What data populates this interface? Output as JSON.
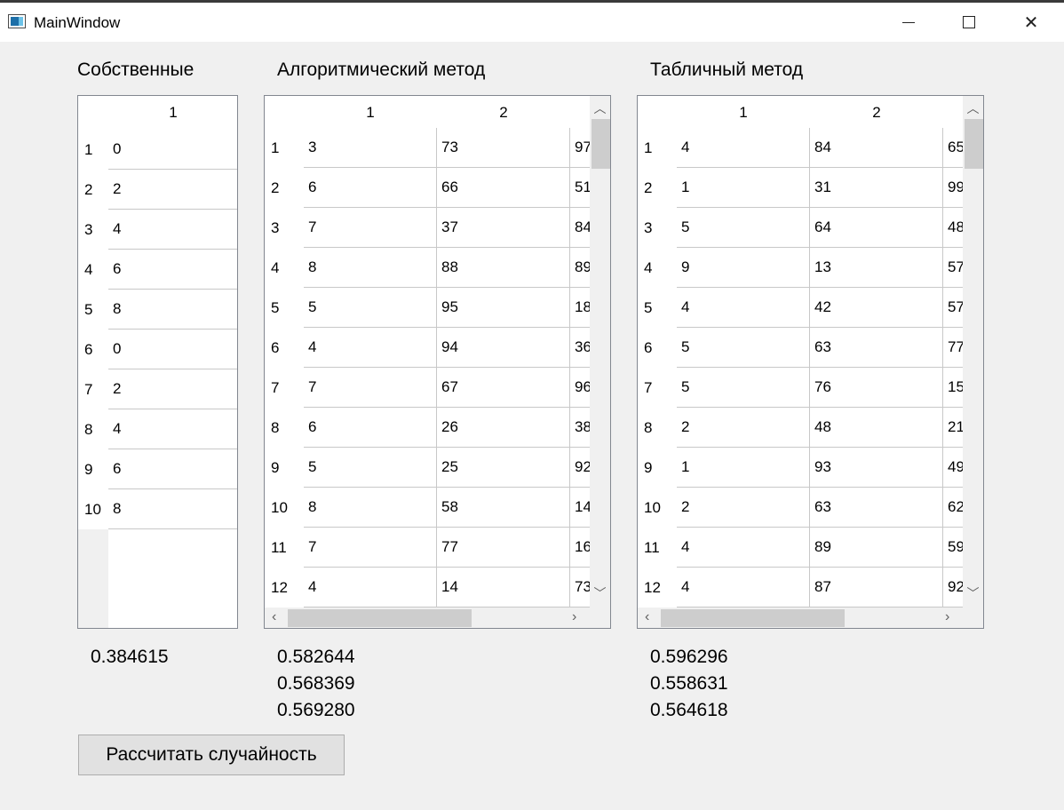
{
  "window": {
    "title": "MainWindow"
  },
  "labels": {
    "own": "Собственные",
    "algorithmic": "Алгоритмический метод",
    "table": "Табличный метод"
  },
  "own_grid": {
    "columns": [
      "1"
    ],
    "rows": [
      "1",
      "2",
      "3",
      "4",
      "5",
      "6",
      "7",
      "8",
      "9",
      "10"
    ],
    "values": [
      "0",
      "2",
      "4",
      "6",
      "8",
      "0",
      "2",
      "4",
      "6",
      "8"
    ]
  },
  "algo_grid": {
    "columns": [
      "1",
      "2"
    ],
    "rows": [
      "1",
      "2",
      "3",
      "4",
      "5",
      "6",
      "7",
      "8",
      "9",
      "10",
      "11",
      "12"
    ],
    "col1": [
      "3",
      "6",
      "7",
      "8",
      "5",
      "4",
      "7",
      "6",
      "5",
      "8",
      "7",
      "4"
    ],
    "col2": [
      "73",
      "66",
      "37",
      "88",
      "95",
      "94",
      "67",
      "26",
      "25",
      "58",
      "77",
      "14"
    ],
    "col3": [
      "97",
      "51",
      "84",
      "89",
      "18",
      "36",
      "96",
      "38",
      "92",
      "14",
      "16",
      "73"
    ]
  },
  "table_grid": {
    "columns": [
      "1",
      "2"
    ],
    "rows": [
      "1",
      "2",
      "3",
      "4",
      "5",
      "6",
      "7",
      "8",
      "9",
      "10",
      "11",
      "12"
    ],
    "col1": [
      "4",
      "1",
      "5",
      "9",
      "4",
      "5",
      "5",
      "2",
      "1",
      "2",
      "4",
      "4"
    ],
    "col2": [
      "84",
      "31",
      "64",
      "13",
      "42",
      "63",
      "76",
      "48",
      "93",
      "63",
      "89",
      "87"
    ],
    "col3": [
      "65",
      "99",
      "48",
      "57",
      "57",
      "77",
      "15",
      "21",
      "49",
      "62",
      "59",
      "92"
    ]
  },
  "results": {
    "own": [
      "0.384615"
    ],
    "algorithmic": [
      "0.582644",
      "0.568369",
      "0.569280"
    ],
    "table": [
      "0.596296",
      "0.558631",
      "0.564618"
    ]
  },
  "buttons": {
    "calculate": "Рассчитать случайность"
  },
  "icons": {
    "minimize": "minimize-icon",
    "maximize": "maximize-icon",
    "close": "close-icon",
    "scroll_up": "chevron-up-icon",
    "scroll_down": "chevron-down-icon",
    "scroll_left": "chevron-left-icon",
    "scroll_right": "chevron-right-icon"
  }
}
